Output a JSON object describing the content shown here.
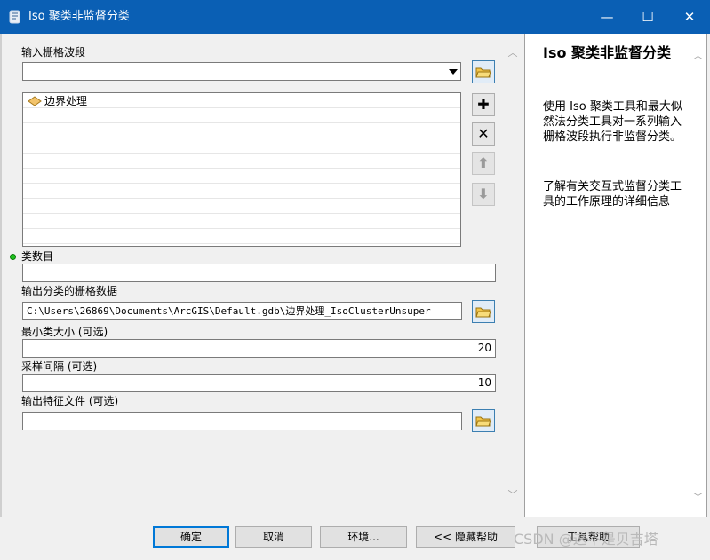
{
  "window": {
    "title": "Iso 聚类非监督分类",
    "minimize": "—",
    "maximize": "☐",
    "close": "✕"
  },
  "form": {
    "input_raster_bands_label": "输入栅格波段",
    "input_raster_bands_value": "",
    "bands_list": [
      {
        "label": "边界处理"
      }
    ],
    "class_count_label": "类数目",
    "class_count_value": "",
    "output_raster_label": "输出分类的栅格数据",
    "output_raster_value": "C:\\Users\\26869\\Documents\\ArcGIS\\Default.gdb\\边界处理_IsoClusterUnsuper",
    "min_class_size_label": "最小类大小 (可选)",
    "min_class_size_value": "20",
    "sample_interval_label": "采样间隔 (可选)",
    "sample_interval_value": "10",
    "output_signature_label": "输出特征文件 (可选)",
    "output_signature_value": ""
  },
  "list_buttons": {
    "add": "✚",
    "remove": "✕",
    "up": "⬆",
    "down": "⬇"
  },
  "help": {
    "title": "Iso 聚类非监督分类",
    "para1": "使用 Iso 聚类工具和最大似然法分类工具对一系列输入栅格波段执行非监督分类。",
    "para2": "了解有关交互式监督分类工具的工作原理的详细信息"
  },
  "scroll": {
    "up": "︿",
    "down": "﹀"
  },
  "buttons": {
    "ok": "确定",
    "cancel": "取消",
    "environments": "环境...",
    "hide_help": "<< 隐藏帮助",
    "tool_help": "工具帮助"
  },
  "watermark": "CSDN @这不是贝吉塔",
  "colors": {
    "titlebar": "#0a5fb4",
    "default_button_border": "#0078d7",
    "required_dot": "#1ec21e"
  },
  "icons": {
    "app": "python-script-icon",
    "folder": "open-folder-icon",
    "raster": "raster-layer-icon"
  }
}
